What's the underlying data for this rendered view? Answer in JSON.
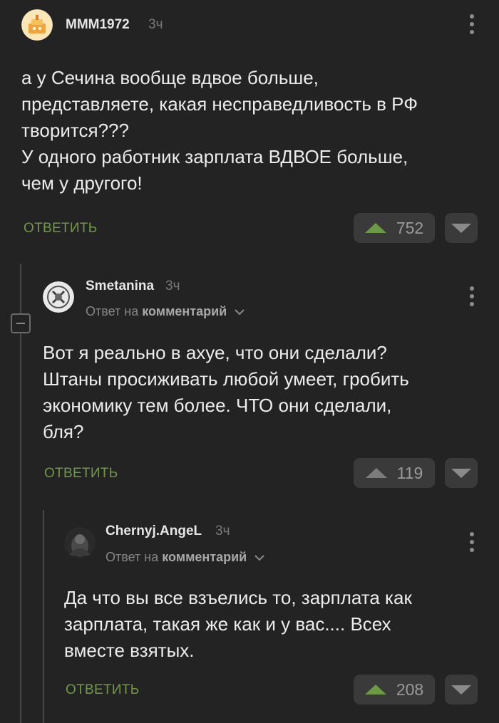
{
  "comments": [
    {
      "username": "MMM1972",
      "time": "3ч",
      "text_lines": [
        "а у Сечина вообще вдвое больше,",
        "представляете, какая несправедливость в РФ",
        "творится???",
        "У одного работник зарплата ВДВОЕ больше,",
        "чем у другого!"
      ],
      "reply_label": "ОТВЕТИТЬ",
      "score": "752",
      "upvoted": true
    },
    {
      "username": "Smetanina",
      "time": "3ч",
      "reply_to_prefix": "Ответ на",
      "reply_to_target": "комментарий",
      "text_lines": [
        "Вот я реально в ахуе, что они сделали?",
        "Штаны просиживать любой умеет, гробить",
        "экономику тем более. ЧТО они сделали,",
        "бля?"
      ],
      "reply_label": "ОТВЕТИТЬ",
      "score": "119",
      "upvoted": false
    },
    {
      "username": "Chernyj.AngeL",
      "time": "3ч",
      "reply_to_prefix": "Ответ на",
      "reply_to_target": "комментарий",
      "text_lines": [
        "Да что вы все взъелись то, зарплата как",
        "зарплата, такая же как и у вас.... Всех",
        "вместе взятых."
      ],
      "reply_label": "ОТВЕТИТЬ",
      "score": "208",
      "upvoted": true
    }
  ],
  "icons": {
    "more": "kebab-icon",
    "upvote": "arrow-up-icon",
    "downvote": "arrow-down-icon",
    "collapse": "minus-icon",
    "chevron": "chevron-down-icon"
  },
  "colors": {
    "background": "#232324",
    "accent_green": "#6f9a45",
    "button_bg": "#3a3a3b"
  }
}
